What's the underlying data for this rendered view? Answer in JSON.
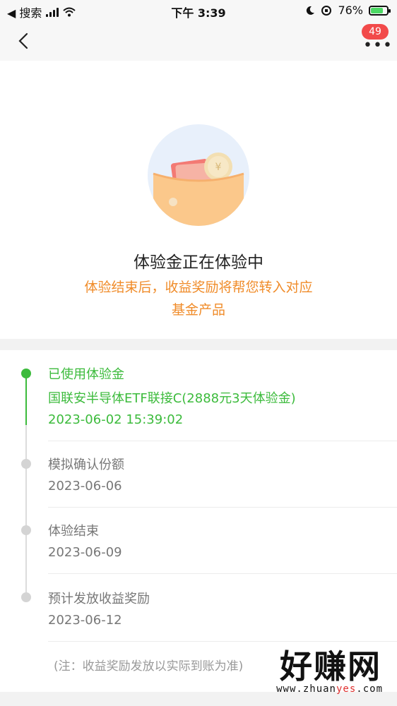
{
  "status_bar": {
    "back_app": "◀ 搜索",
    "time": "下午 3:39",
    "battery": "76%"
  },
  "nav": {
    "badge": "49"
  },
  "hero": {
    "title": "体验金正在体验中",
    "desc_line1": "体验结束后，收益奖励将帮您转入对应",
    "desc_line2": "基金产品"
  },
  "timeline": {
    "steps": [
      {
        "title": "已使用体验金",
        "detail": "国联安半导体ETF联接C(2888元3天体验金)",
        "date": "2023-06-02   15:39:02"
      },
      {
        "title": "模拟确认份额",
        "date": "2023-06-06"
      },
      {
        "title": "体验结束",
        "date": "2023-06-09"
      },
      {
        "title": "预计发放收益奖励",
        "date": "2023-06-12"
      }
    ],
    "note": "(注：收益奖励发放以实际到账为准)"
  },
  "watermark": {
    "main": "好赚网",
    "sub_a": "www.zhuan",
    "sub_b": "yes",
    "sub_c": ".com"
  },
  "colors": {
    "accent_green": "#3cbb3c",
    "accent_orange": "#f08c2a",
    "badge_red": "#f24a4a"
  }
}
